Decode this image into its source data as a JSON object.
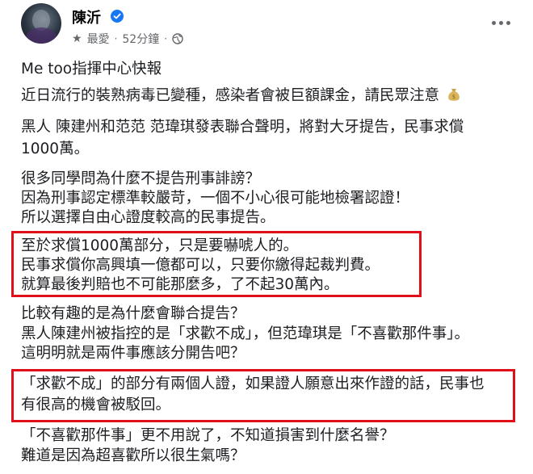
{
  "post": {
    "author": "陳沂",
    "favorite_label": "最愛",
    "separator": "·",
    "time": "52分鐘",
    "lines": {
      "l1": "Me too指揮中心快報",
      "l2": "近日流行的裝熟病毒已變種，感染者會被巨額課金，請民眾注意",
      "l3": "黑人 陳建州和范范 范瑋琪發表聯合聲明，將對大牙提告，民事求償",
      "l4": "1000萬。",
      "l5": "很多同學問為什麼不提告刑事誹謗？",
      "l6": "因為刑事認定標準較嚴苛，一個不小心很可能地檢署認證！",
      "l7": "所以選擇自由心證度較高的民事提告。",
      "l8": "至於求償1000萬部分，只是要嚇唬人的。",
      "l9": "民事求償你高興填一億都可以，只要你繳得起裁判費。",
      "l10": "就算最後判賠也不可能那麼多，了不起30萬內。",
      "l11": "比較有趣的是為什麼會聯合提告？",
      "l12": "黑人陳建州被指控的是「求歡不成」，但范瑋琪是「不喜歡那件事」。",
      "l13": "這明明就是兩件事應該分開告吧？",
      "l14": "「求歡不成」的部分有兩個人證，如果證人願意出來作證的話，民事也",
      "l15": "有很高的機會被駁回。",
      "l16": "「不喜歡那件事」更不用說了，不知道損害到什麼名譽？",
      "l17": "難道是因為超喜歡所以很生氣嗎？"
    }
  },
  "icons": {
    "verified": "verified-badge-icon",
    "star": "star-icon",
    "globe": "globe-icon",
    "more": "more-options-icon",
    "moneybag": "money-bag-icon"
  },
  "colors": {
    "highlight_border": "#e0101b",
    "verified": "#1877f2",
    "meta_text": "#65676b"
  }
}
